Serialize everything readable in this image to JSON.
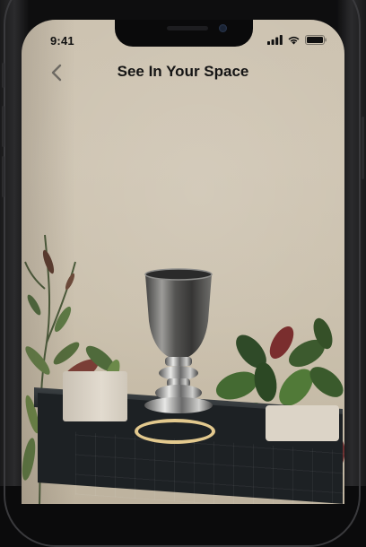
{
  "status_bar": {
    "time": "9:41"
  },
  "nav": {
    "title": "See In Your Space",
    "back_icon": "chevron-left-icon"
  },
  "ar": {
    "placement_indicator": "placement-ring",
    "ring_color": "#e3c98e"
  },
  "colors": {
    "title_text": "#151515",
    "frame": "#0e0e0f",
    "wall": "#cdc3b1"
  }
}
